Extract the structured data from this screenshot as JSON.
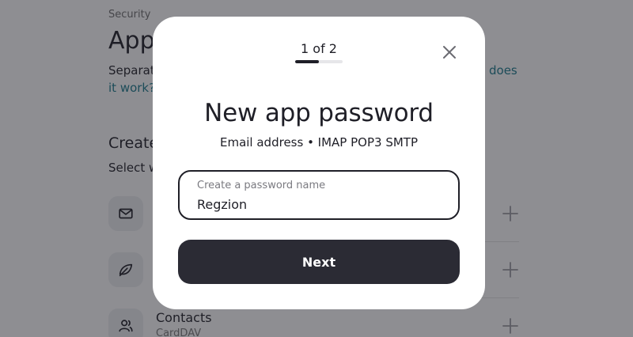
{
  "background": {
    "breadcrumb": "Security",
    "page_title": "App",
    "description_start": "Separat",
    "how_link_part1": "does",
    "how_link_part2": "it work?",
    "section_title": "Create",
    "section_subtitle": "Select w",
    "rows": [
      {
        "icon": "mail-icon"
      },
      {
        "icon": "leaf-icon"
      },
      {
        "icon": "contacts-icon",
        "title": "Contacts",
        "subtitle": "CardDAV"
      }
    ],
    "plus_icon": "plus-icon"
  },
  "modal": {
    "step_text": "1 of 2",
    "progress": {
      "current": 1,
      "total": 2
    },
    "close_icon": "close-icon",
    "title": "New app password",
    "subtitle": "Email address • IMAP POP3 SMTP",
    "input": {
      "label": "Create a password name",
      "value": "Regzion"
    },
    "next_label": "Next"
  },
  "colors": {
    "overlay": "#1e1e26",
    "text_dark": "#1f1f27",
    "link": "#1b7a8c",
    "button_bg": "#2b2b34",
    "button_text": "#ffffff"
  }
}
